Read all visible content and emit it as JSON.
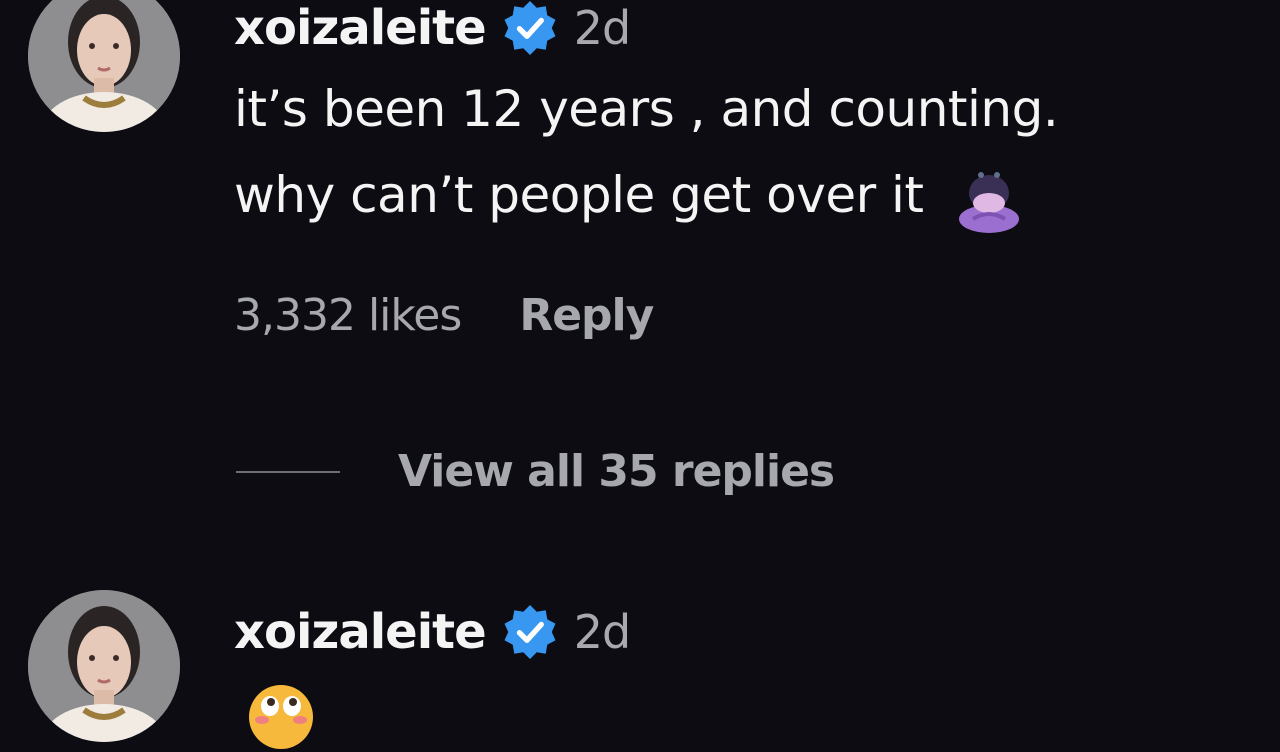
{
  "comments": [
    {
      "username": "xoizaleite",
      "time": "2d",
      "verified": true,
      "avatar_icon": "user-avatar",
      "text_lines": [
        "it’s been 12 years , and counting.",
        "why can’t people get over it"
      ],
      "emoji_icon": "woman-bowing-emoji",
      "likes": "3,332 likes",
      "reply_label": "Reply",
      "view_replies": "View all 35 replies"
    },
    {
      "username": "xoizaleite",
      "time": "2d",
      "verified": true,
      "avatar_icon": "user-avatar",
      "emoji_icon": "face-emoji"
    }
  ],
  "colors": {
    "background": "#0c0c12",
    "verified_badge": "#3897f0",
    "secondary_text": "#a7a7ae"
  }
}
